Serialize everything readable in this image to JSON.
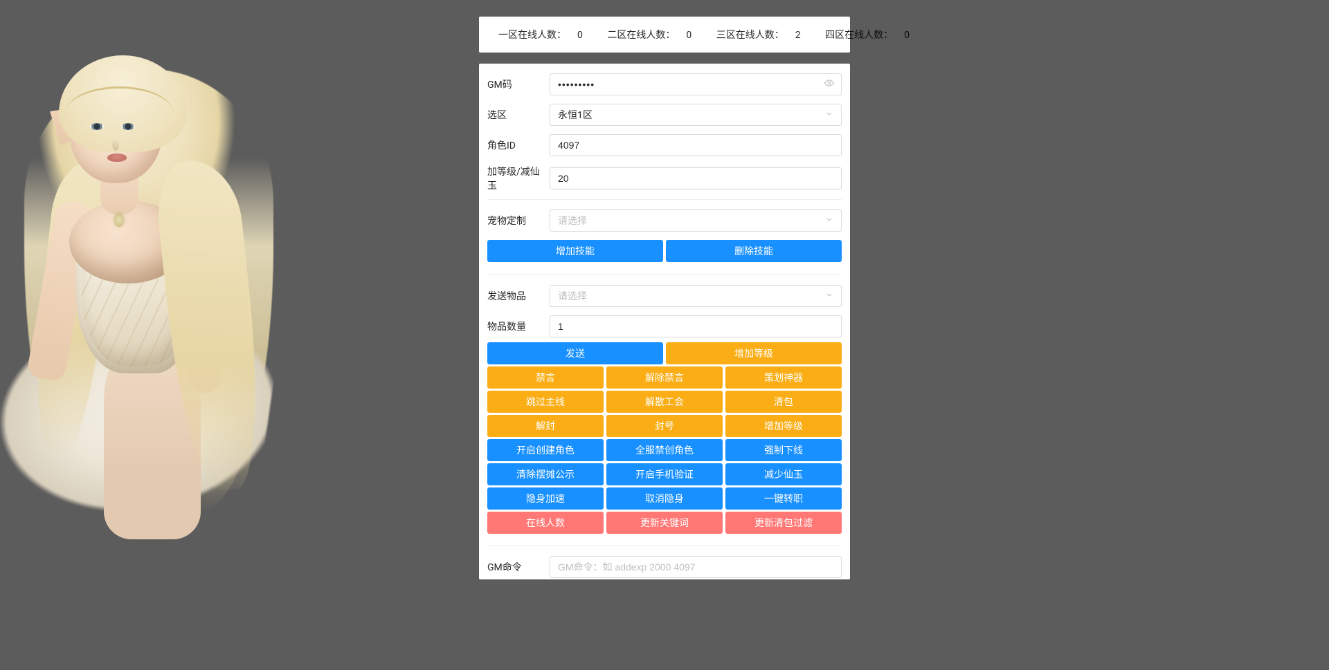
{
  "status": {
    "zone1_label": "一区在线人数：",
    "zone1_value": "0",
    "zone2_label": "二区在线人数：",
    "zone2_value": "0",
    "zone3_label": "三区在线人数：",
    "zone3_value": "2",
    "zone4_label": "四区在线人数：",
    "zone4_value": "0"
  },
  "form": {
    "gm_code_label": "GM码",
    "gm_code_value": "•••••••••",
    "zone_label": "选区",
    "zone_value": "永恒1区",
    "role_id_label": "角色ID",
    "role_id_value": "4097",
    "level_label": "加等级/减仙玉",
    "level_value": "20"
  },
  "pet": {
    "label": "宠物定制",
    "placeholder": "请选择",
    "add_skill": "增加技能",
    "del_skill": "删除技能"
  },
  "send": {
    "item_label": "发送物品",
    "item_placeholder": "请选择",
    "qty_label": "物品数量",
    "qty_value": "1"
  },
  "actions": {
    "row1": {
      "a": "发送",
      "b": "增加等级"
    },
    "row2": {
      "a": "禁言",
      "b": "解除禁言",
      "c": "策划神器"
    },
    "row3": {
      "a": "跳过主线",
      "b": "解散工会",
      "c": "清包"
    },
    "row4": {
      "a": "解封",
      "b": "封号",
      "c": "增加等级"
    },
    "row5": {
      "a": "开启创建角色",
      "b": "全服禁创角色",
      "c": "强制下线"
    },
    "row6": {
      "a": "清除摆摊公示",
      "b": "开启手机验证",
      "c": "减少仙玉"
    },
    "row7": {
      "a": "隐身加速",
      "b": "取消隐身",
      "c": "一键转职"
    },
    "row8": {
      "a": "在线人数",
      "b": "更新关键词",
      "c": "更新清包过滤"
    }
  },
  "gm_cmd": {
    "label": "GM命令",
    "placeholder": "GM命令：如 addexp 2000 4097"
  }
}
